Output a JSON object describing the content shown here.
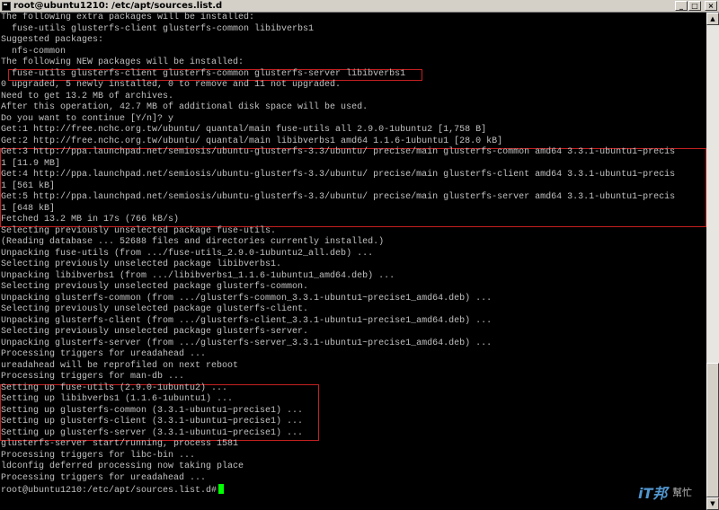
{
  "window": {
    "title": "root@ubuntu1210: /etc/apt/sources.list.d",
    "minimize_glyph": "_",
    "maximize_glyph": "□",
    "close_glyph": "×"
  },
  "terminal": {
    "lines": [
      "The following extra packages will be installed:",
      "  fuse-utils glusterfs-client glusterfs-common libibverbs1",
      "Suggested packages:",
      "  nfs-common",
      "The following NEW packages will be installed:",
      "  fuse-utils glusterfs-client glusterfs-common glusterfs-server libibverbs1",
      "0 upgraded, 5 newly installed, 0 to remove and 11 not upgraded.",
      "Need to get 13.2 MB of archives.",
      "After this operation, 42.7 MB of additional disk space will be used.",
      "Do you want to continue [Y/n]? y",
      "Get:1 http://free.nchc.org.tw/ubuntu/ quantal/main fuse-utils all 2.9.0-1ubuntu2 [1,758 B]",
      "Get:2 http://free.nchc.org.tw/ubuntu/ quantal/main libibverbs1 amd64 1.1.6-1ubuntu1 [28.0 kB]",
      "Get:3 http://ppa.launchpad.net/semiosis/ubuntu-glusterfs-3.3/ubuntu/ precise/main glusterfs-common amd64 3.3.1-ubuntu1~precis",
      "1 [11.9 MB]",
      "Get:4 http://ppa.launchpad.net/semiosis/ubuntu-glusterfs-3.3/ubuntu/ precise/main glusterfs-client amd64 3.3.1-ubuntu1~precis",
      "1 [561 kB]",
      "Get:5 http://ppa.launchpad.net/semiosis/ubuntu-glusterfs-3.3/ubuntu/ precise/main glusterfs-server amd64 3.3.1-ubuntu1~precis",
      "1 [648 kB]",
      "Fetched 13.2 MB in 17s (766 kB/s)",
      "Selecting previously unselected package fuse-utils.",
      "(Reading database ... 52688 files and directories currently installed.)",
      "Unpacking fuse-utils (from .../fuse-utils_2.9.0-1ubuntu2_all.deb) ...",
      "Selecting previously unselected package libibverbs1.",
      "Unpacking libibverbs1 (from .../libibverbs1_1.1.6-1ubuntu1_amd64.deb) ...",
      "Selecting previously unselected package glusterfs-common.",
      "Unpacking glusterfs-common (from .../glusterfs-common_3.3.1-ubuntu1~precise1_amd64.deb) ...",
      "Selecting previously unselected package glusterfs-client.",
      "Unpacking glusterfs-client (from .../glusterfs-client_3.3.1-ubuntu1~precise1_amd64.deb) ...",
      "Selecting previously unselected package glusterfs-server.",
      "Unpacking glusterfs-server (from .../glusterfs-server_3.3.1-ubuntu1~precise1_amd64.deb) ...",
      "Processing triggers for ureadahead ...",
      "ureadahead will be reprofiled on next reboot",
      "Processing triggers for man-db ...",
      "Setting up fuse-utils (2.9.0-1ubuntu2) ...",
      "Setting up libibverbs1 (1.1.6-1ubuntu1) ...",
      "Setting up glusterfs-common (3.3.1-ubuntu1~precise1) ...",
      "Setting up glusterfs-client (3.3.1-ubuntu1~precise1) ...",
      "Setting up glusterfs-server (3.3.1-ubuntu1~precise1) ...",
      "glusterfs-server start/running, process 1581",
      "Processing triggers for libc-bin ...",
      "ldconfig deferred processing now taking place",
      "Processing triggers for ureadahead ...",
      "root@ubuntu1210:/etc/apt/sources.list.d#"
    ],
    "cursor_color": "#00ff00",
    "text_color": "#c0c0c0",
    "highlight_color": "#c42020"
  },
  "watermark": {
    "main": "iT邦",
    "sub": "幫忙"
  }
}
